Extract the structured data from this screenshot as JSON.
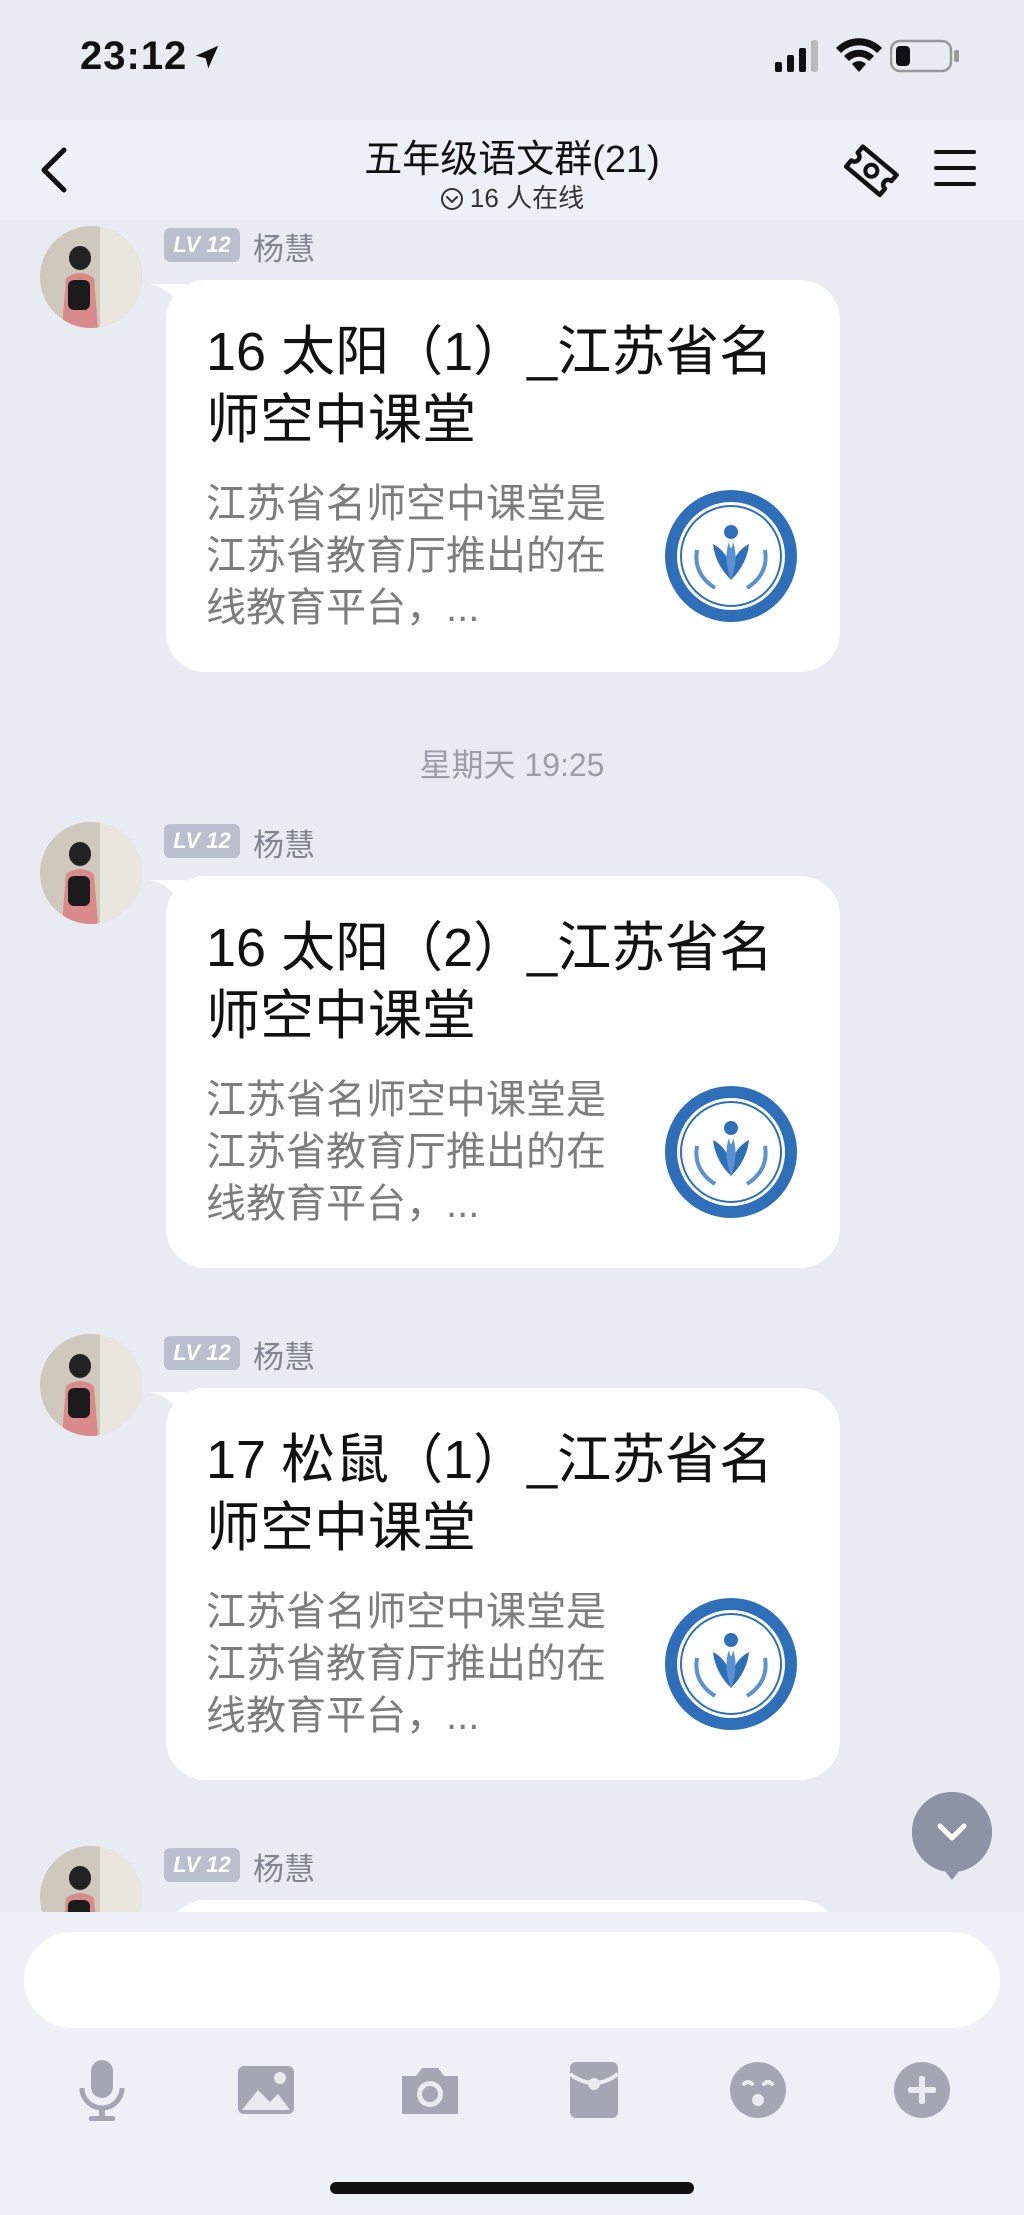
{
  "status_bar": {
    "time": "23:12"
  },
  "nav": {
    "title": "五年级语文群(21)",
    "online": "16 人在线"
  },
  "messages": [
    {
      "badge": "LV 12",
      "sender": "杨慧",
      "title": "16 太阳（1）_江苏省名师空中课堂",
      "desc": "江苏省名师空中课堂是江苏省教育厅推出的在线教育平台，..."
    },
    {
      "badge": "LV 12",
      "sender": "杨慧",
      "title": "16 太阳（2）_江苏省名师空中课堂",
      "desc": "江苏省名师空中课堂是江苏省教育厅推出的在线教育平台，..."
    },
    {
      "badge": "LV 12",
      "sender": "杨慧",
      "title": "17 松鼠（1）_江苏省名师空中课堂",
      "desc": "江苏省名师空中课堂是江苏省教育厅推出的在线教育平台，..."
    },
    {
      "badge": "LV 12",
      "sender": "杨慧"
    }
  ],
  "timestamp": "星期天 19:25",
  "input": {
    "value": "",
    "placeholder": ""
  },
  "toolbar": [
    "microphone-icon",
    "image-icon",
    "camera-icon",
    "red-packet-icon",
    "emoji-icon",
    "plus-icon"
  ],
  "colors": {
    "background": "#e9ebf3",
    "card": "#ffffff",
    "logo_blue": "#2f6fba",
    "tool_grey": "#a3a7b4"
  }
}
